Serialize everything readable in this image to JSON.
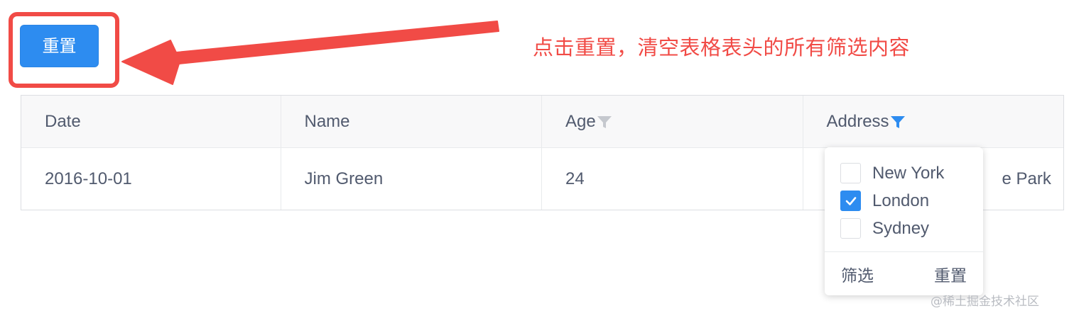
{
  "toolbar": {
    "reset_label": "重置"
  },
  "annotation": {
    "text": "点击重置，清空表格表头的所有筛选内容"
  },
  "table": {
    "headers": {
      "date": "Date",
      "name": "Name",
      "age": "Age",
      "address": "Address"
    },
    "rows": [
      {
        "date": "2016-10-01",
        "name": "Jim Green",
        "age": "24",
        "address": "e Park"
      }
    ]
  },
  "filter_dropdown": {
    "options": [
      {
        "label": "New York",
        "checked": false
      },
      {
        "label": "London",
        "checked": true
      },
      {
        "label": "Sydney",
        "checked": false
      }
    ],
    "confirm_label": "筛选",
    "reset_label": "重置"
  },
  "watermark": "@稀土掘金技术社区",
  "icons": {
    "age_filter": "filter-icon",
    "address_filter": "filter-icon",
    "checkmark": "check-icon"
  },
  "colors": {
    "primary": "#2d8cf0",
    "annotation_red": "#f14b46",
    "filter_inactive": "#c5c8ce",
    "filter_active": "#2d8cf0"
  }
}
